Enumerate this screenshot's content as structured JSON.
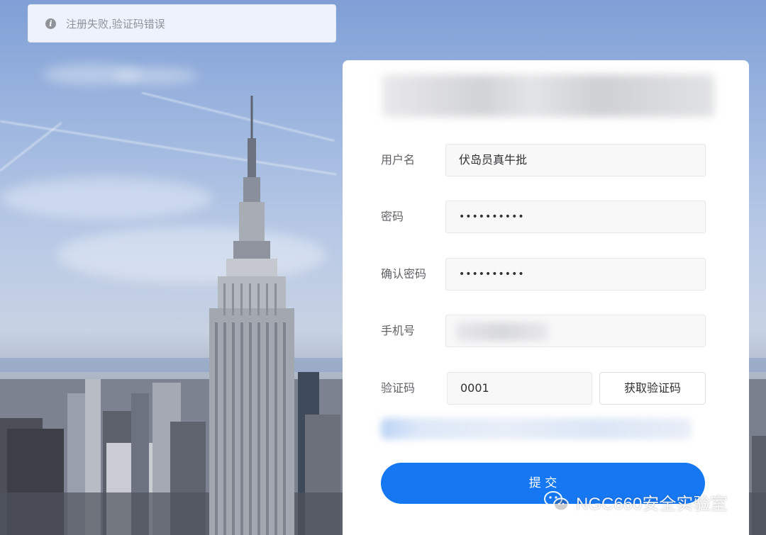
{
  "notification": {
    "icon": "info-icon",
    "message": "注册失败,验证码错误"
  },
  "form": {
    "username": {
      "label": "用户名",
      "value": "伏岛员真牛批"
    },
    "password": {
      "label": "密码",
      "value": "••••••••••"
    },
    "confirm_password": {
      "label": "确认密码",
      "value": "••••••••••"
    },
    "phone": {
      "label": "手机号",
      "value": ""
    },
    "captcha": {
      "label": "验证码",
      "value": "0001",
      "button_label": "获取验证码"
    },
    "submit_label": "提 交"
  },
  "watermark": {
    "icon": "wechat-icon",
    "text": "NGC660安全实验室"
  },
  "colors": {
    "primary": "#1677f2",
    "toast_bg": "#edf2fc",
    "input_bg": "#f8f8f9"
  }
}
